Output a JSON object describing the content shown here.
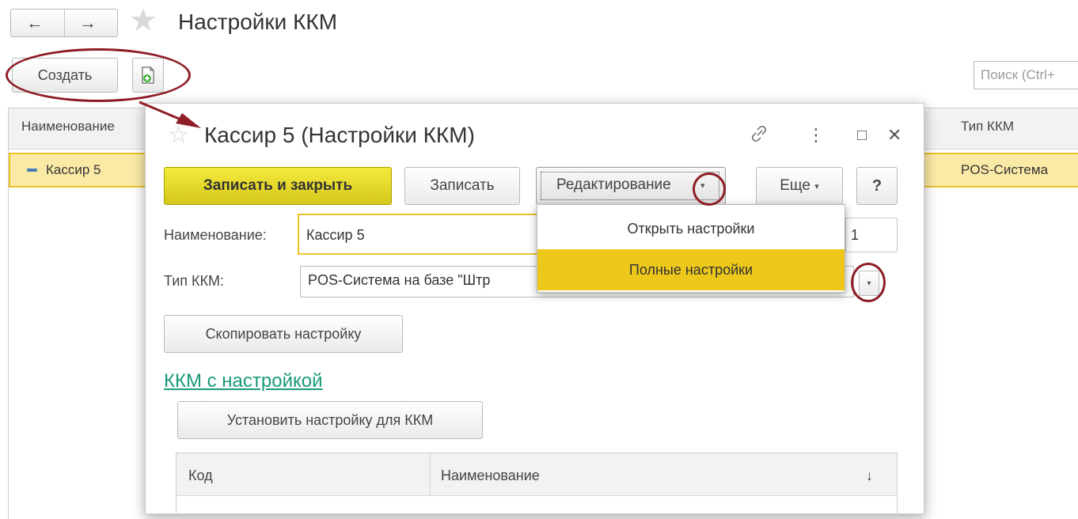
{
  "window": {
    "title": "Настройки ККМ",
    "nav_back": "←",
    "nav_forward": "→",
    "favorite_star": "★"
  },
  "toolbar": {
    "create_label": "Создать",
    "search_placeholder": "Поиск (Ctrl+"
  },
  "list_table": {
    "columns": [
      "Наименование",
      "Тип ККМ"
    ],
    "rows": [
      {
        "name": "Кассир 5",
        "type": "POS-Система"
      }
    ]
  },
  "dialog": {
    "title": "Кассир 5 (Настройки ККМ)",
    "star": "☆",
    "link_icon": "⊘",
    "menu_icon": "⋮",
    "maximize_icon": "□",
    "close_icon": "✕",
    "buttons": {
      "save_close": "Записать и закрыть",
      "save": "Записать",
      "edit": "Редактирование",
      "more": "Еще",
      "help": "?",
      "copy_settings": "Скопировать настройку",
      "set_for_kkm": "Установить настройку для ККМ"
    },
    "caret": "▾",
    "fields": {
      "name_label": "Наименование:",
      "name_value": "Кассир 5",
      "code_value": "1",
      "type_label": "Тип ККМ:",
      "type_value": "POS-Система на базе \"Штр"
    },
    "section_link": "ККМ с настройкой",
    "inner_table": {
      "col_code": "Код",
      "col_name": "Наименование",
      "sort_icon": "↓"
    }
  },
  "popup_menu": {
    "items": [
      {
        "label": "Открыть настройки",
        "selected": false
      },
      {
        "label": "Полные настройки",
        "selected": true
      }
    ],
    "selected_color": "#edc81b"
  },
  "colors": {
    "annotation": "#8e1d27",
    "primary_button": "#e6da2c",
    "selection_row": "#fbeaa6",
    "link": "#1a9a7a"
  }
}
